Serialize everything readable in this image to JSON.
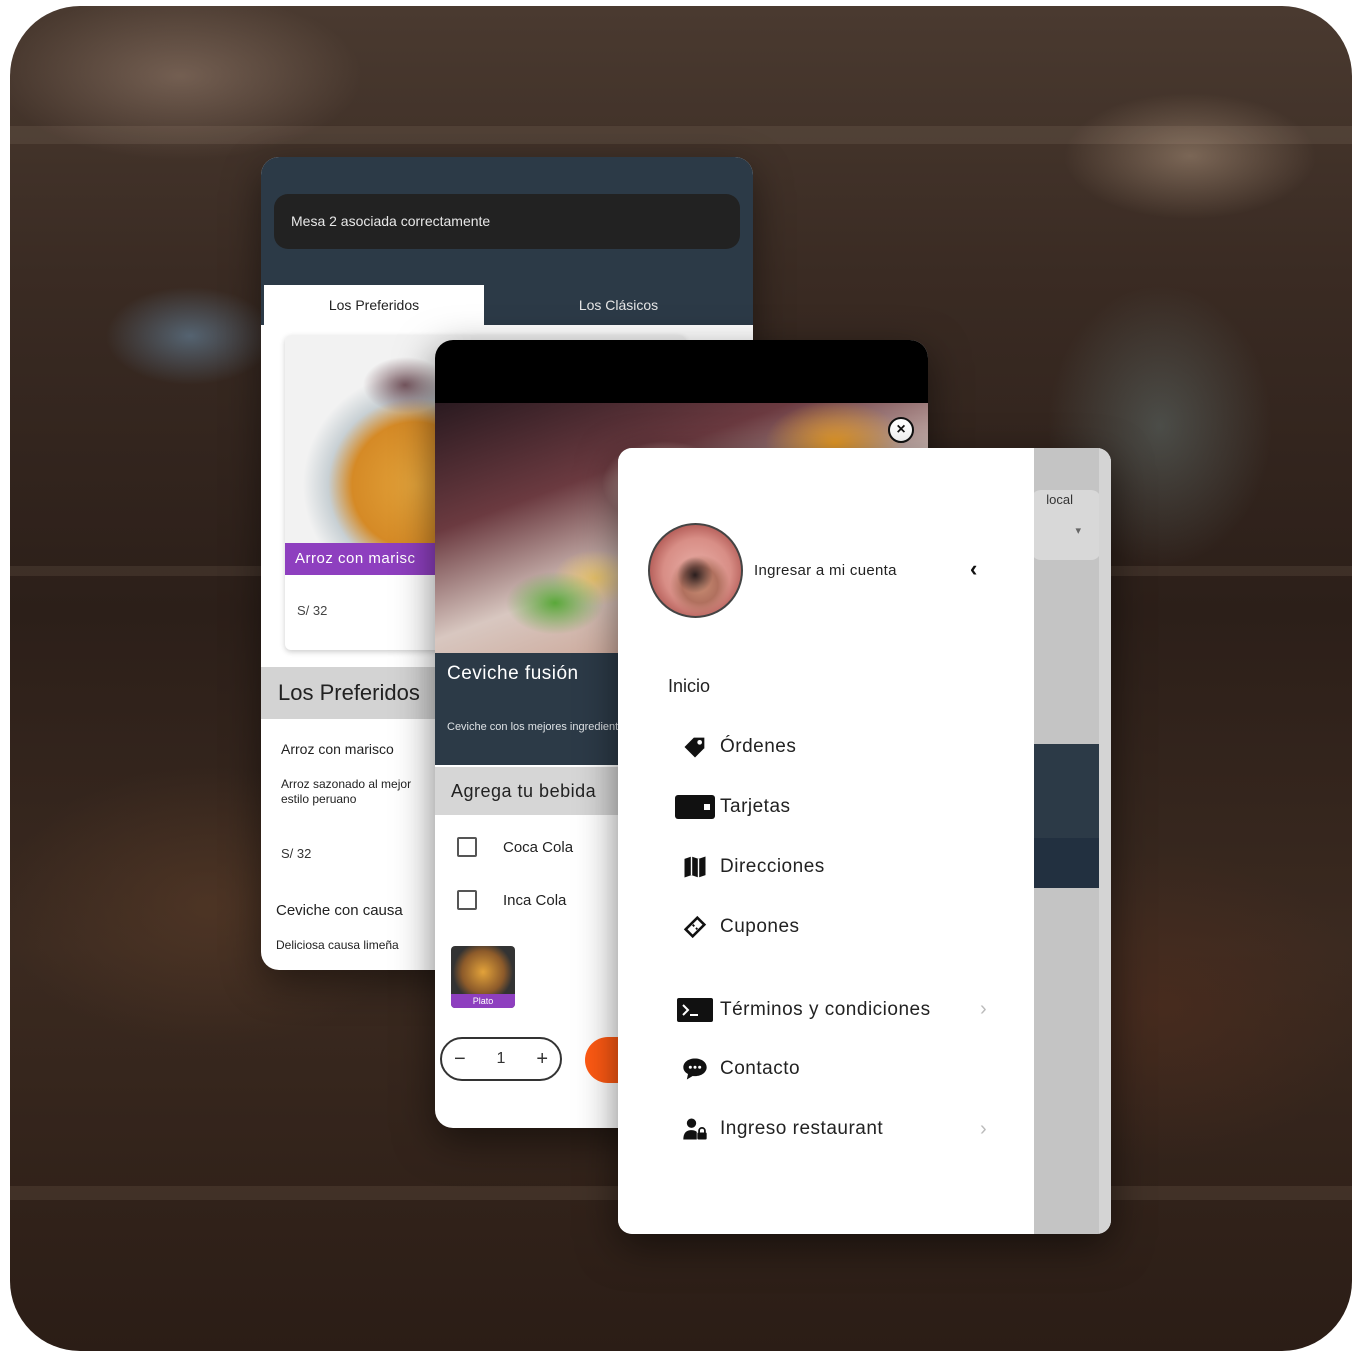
{
  "menu_screen": {
    "mesa_text": "Mesa 2 asociada correctamente",
    "tabs": [
      {
        "label": "Los Preferidos",
        "active": true
      },
      {
        "label": "Los Clásicos",
        "active": false
      }
    ],
    "featured": {
      "name": "Arroz con marisc",
      "price": "S/ 32"
    },
    "section_title": "Los Preferidos",
    "items": [
      {
        "name": "Arroz con marisco",
        "desc": "Arroz sazonado al mejor estilo peruano",
        "price": "S/ 32"
      },
      {
        "name": "Ceviche con causa",
        "desc": "Deliciosa causa limeña"
      }
    ]
  },
  "dish_screen": {
    "title": "Ceviche fusión",
    "description": "Ceviche con los mejores ingredientes",
    "drinks_header": "Agrega tu bebida",
    "options": [
      {
        "label": "Coca Cola",
        "checked": false
      },
      {
        "label": "Inca Cola",
        "checked": false
      }
    ],
    "thumb_label": "Plato",
    "quantity": "1",
    "minus": "−",
    "plus": "+",
    "close_icon": "×"
  },
  "drawer": {
    "account_label": "Ingresar a mi cuenta",
    "back_icon": "‹",
    "section_label": "Inicio",
    "items": [
      {
        "label": "Órdenes",
        "icon": "tag-icon"
      },
      {
        "label": "Tarjetas",
        "icon": "wallet-icon"
      },
      {
        "label": "Direcciones",
        "icon": "map-icon"
      },
      {
        "label": "Cupones",
        "icon": "coupon-icon"
      },
      {
        "label": "Términos y condiciones",
        "icon": "terminal-icon",
        "chevron": true
      },
      {
        "label": "Contacto",
        "icon": "chat-icon"
      },
      {
        "label": "Ingreso restaurant",
        "icon": "user-lock-icon",
        "chevron": true
      }
    ],
    "chevron": "›",
    "background_label": "local",
    "background_caret": "▾"
  },
  "colors": {
    "navy": "#2c3a47",
    "purple": "#8e3fbf",
    "orange": "#ff5a13"
  }
}
